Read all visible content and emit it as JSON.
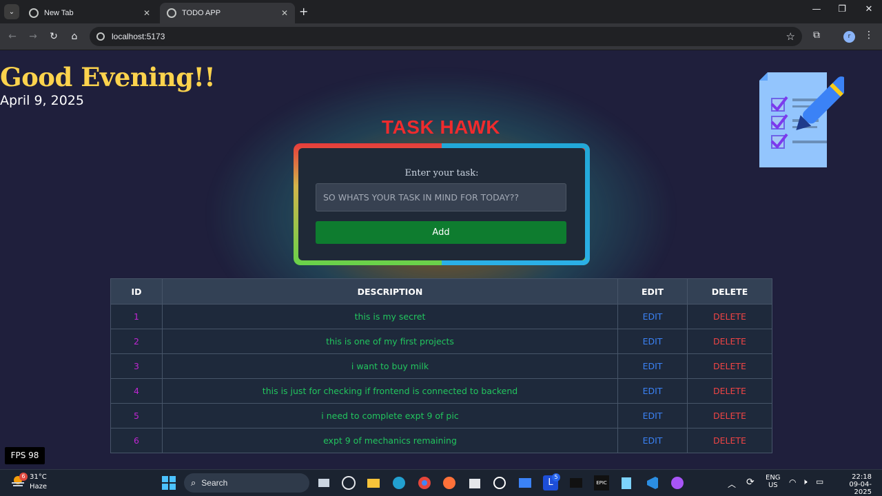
{
  "browser": {
    "tabs": [
      {
        "title": "New Tab",
        "active": false
      },
      {
        "title": "TODO APP",
        "active": true
      }
    ],
    "url": "localhost:5173",
    "profile_initial": "r"
  },
  "page": {
    "greeting": "Good Evening!!",
    "date": "April 9, 2025",
    "app_title": "TASK HAWK",
    "form": {
      "label": "Enter your task:",
      "placeholder": "SO WHATS YOUR TASK IN MIND FOR TODAY??",
      "value": "",
      "add_label": "Add"
    },
    "table": {
      "headers": [
        "ID",
        "DESCRIPTION",
        "EDIT",
        "DELETE"
      ],
      "rows": [
        {
          "id": "1",
          "description": "this is my secret",
          "edit": "EDIT",
          "delete": "DELETE"
        },
        {
          "id": "2",
          "description": "this is one of my first projects",
          "edit": "EDIT",
          "delete": "DELETE"
        },
        {
          "id": "3",
          "description": "i want to buy milk",
          "edit": "EDIT",
          "delete": "DELETE"
        },
        {
          "id": "4",
          "description": "this is just for checking if frontend is connected to backend",
          "edit": "EDIT",
          "delete": "DELETE"
        },
        {
          "id": "5",
          "description": "i need to complete expt 9 of pic",
          "edit": "EDIT",
          "delete": "DELETE"
        },
        {
          "id": "6",
          "description": "expt 9 of mechanics remaining",
          "edit": "EDIT",
          "delete": "DELETE"
        }
      ]
    },
    "fps": "FPS 98"
  },
  "taskbar": {
    "weather": {
      "temp": "31°C",
      "desc": "Haze",
      "badge": "6"
    },
    "search_label": "Search",
    "notification_badge": "5",
    "lang": "ENG",
    "region": "US",
    "time": "22:18",
    "date": "09-04-2025"
  },
  "colors": {
    "greeting": "#fcd34d",
    "title": "#ef2b2d",
    "id": "#c026d3",
    "description": "#22c55e",
    "edit": "#3b82f6",
    "delete": "#ef4444",
    "add_button": "#0e7c2f"
  }
}
